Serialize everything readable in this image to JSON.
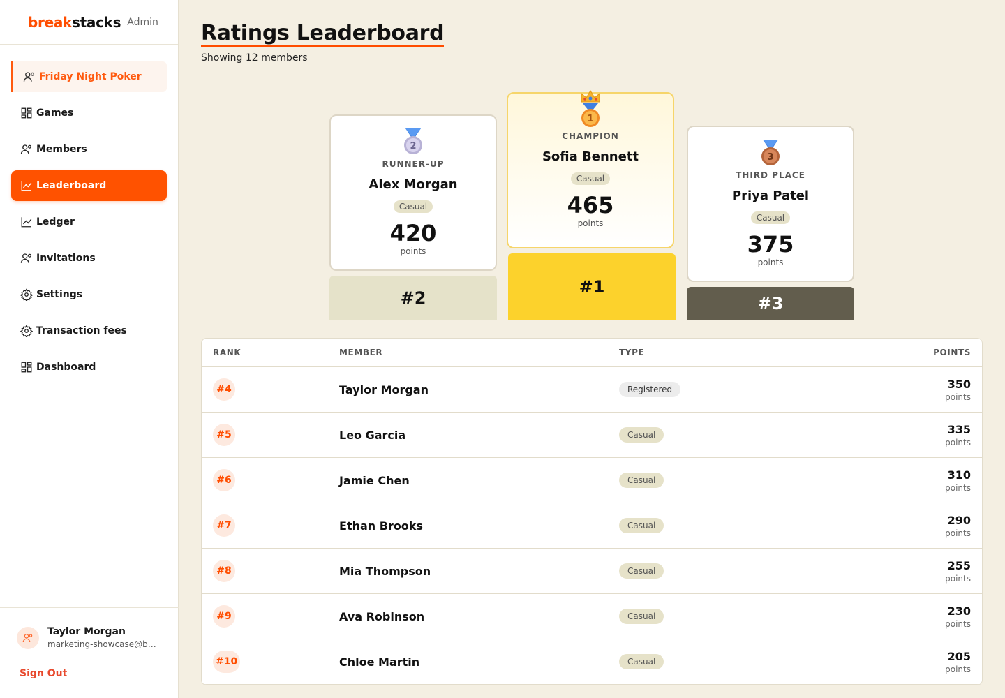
{
  "brand": {
    "part1": "break",
    "part2": "stacks",
    "suffix": "Admin"
  },
  "sidebar": {
    "group": "Friday Night Poker",
    "items": [
      {
        "label": "Games",
        "icon": "grid-icon"
      },
      {
        "label": "Members",
        "icon": "users-icon"
      },
      {
        "label": "Leaderboard",
        "icon": "chart-icon"
      },
      {
        "label": "Ledger",
        "icon": "chart-icon"
      },
      {
        "label": "Invitations",
        "icon": "users-icon"
      },
      {
        "label": "Settings",
        "icon": "gear-icon"
      },
      {
        "label": "Transaction fees",
        "icon": "gear-icon"
      },
      {
        "label": "Dashboard",
        "icon": "grid-icon"
      }
    ],
    "active": "Leaderboard",
    "user": {
      "name": "Taylor Morgan",
      "email": "marketing-showcase@breakstacks.com"
    },
    "sign_out": "Sign Out"
  },
  "page": {
    "title": "Ratings Leaderboard",
    "subtitle": "Showing 12 members"
  },
  "podium": {
    "second": {
      "label": "RUNNER-UP",
      "name": "Alex Morgan",
      "type": "Casual",
      "points": "420",
      "points_label": "points",
      "block": "#2",
      "medal": "2"
    },
    "first": {
      "label": "CHAMPION",
      "name": "Sofia Bennett",
      "type": "Casual",
      "points": "465",
      "points_label": "points",
      "block": "#1",
      "medal": "1"
    },
    "third": {
      "label": "THIRD PLACE",
      "name": "Priya Patel",
      "type": "Casual",
      "points": "375",
      "points_label": "points",
      "block": "#3",
      "medal": "3"
    }
  },
  "table": {
    "headers": {
      "rank": "RANK",
      "member": "MEMBER",
      "type": "TYPE",
      "points": "POINTS"
    },
    "points_label": "points",
    "rows": [
      {
        "rank": "#4",
        "member": "Taylor Morgan",
        "type": "Registered",
        "points": "350"
      },
      {
        "rank": "#5",
        "member": "Leo Garcia",
        "type": "Casual",
        "points": "335"
      },
      {
        "rank": "#6",
        "member": "Jamie Chen",
        "type": "Casual",
        "points": "310"
      },
      {
        "rank": "#7",
        "member": "Ethan Brooks",
        "type": "Casual",
        "points": "290"
      },
      {
        "rank": "#8",
        "member": "Mia Thompson",
        "type": "Casual",
        "points": "255"
      },
      {
        "rank": "#9",
        "member": "Ava Robinson",
        "type": "Casual",
        "points": "230"
      },
      {
        "rank": "#10",
        "member": "Chloe Martin",
        "type": "Casual",
        "points": "205"
      }
    ]
  },
  "colors": {
    "accent": "#ff5200",
    "gold": "#fcd22c",
    "silver": "#e5e2c9",
    "bronze": "#625d4d"
  }
}
